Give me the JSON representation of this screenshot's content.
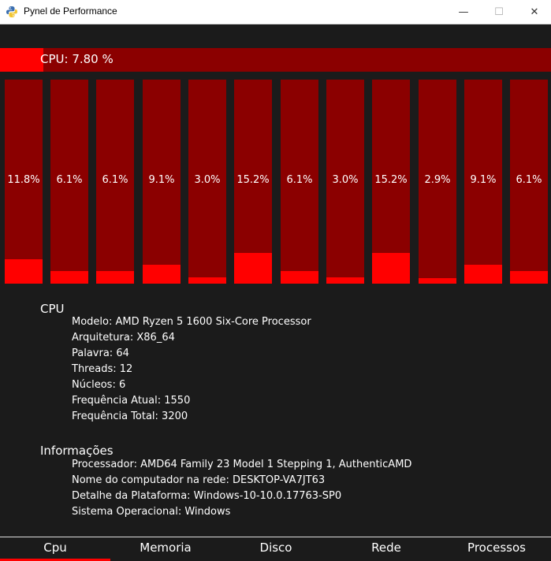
{
  "window": {
    "title": "Pynel de Performance",
    "minimize_glyph": "—",
    "maximize_glyph": "☐",
    "close_glyph": "✕",
    "icon": "python-icon"
  },
  "colors": {
    "background": "#1b1b1b",
    "bar_track": "#8b0000",
    "bar_fill": "#ff0000",
    "text": "#ffffff"
  },
  "cpu_total": {
    "label": "CPU: 7.80 %",
    "percent": 7.8
  },
  "cores": [
    {
      "label": "11.8%",
      "percent": 11.8
    },
    {
      "label": "6.1%",
      "percent": 6.1
    },
    {
      "label": "6.1%",
      "percent": 6.1
    },
    {
      "label": "9.1%",
      "percent": 9.1
    },
    {
      "label": "3.0%",
      "percent": 3.0
    },
    {
      "label": "15.2%",
      "percent": 15.2
    },
    {
      "label": "6.1%",
      "percent": 6.1
    },
    {
      "label": "3.0%",
      "percent": 3.0
    },
    {
      "label": "15.2%",
      "percent": 15.2
    },
    {
      "label": "2.9%",
      "percent": 2.9
    },
    {
      "label": "9.1%",
      "percent": 9.1
    },
    {
      "label": "6.1%",
      "percent": 6.1
    }
  ],
  "cpu_info": {
    "title": "CPU",
    "lines": [
      "Modelo: AMD Ryzen 5 1600 Six-Core Processor",
      "Arquitetura: X86_64",
      "Palavra: 64",
      "Threads: 12",
      "Núcleos: 6",
      "Frequência Atual: 1550",
      "Frequência Total: 3200"
    ]
  },
  "system_info": {
    "title": "Informações",
    "lines": [
      "Processador: AMD64 Family 23 Model 1 Stepping 1, AuthenticAMD",
      "Nome do computador na rede: DESKTOP-VA7JT63",
      "Detalhe da Plataforma: Windows-10-10.0.17763-SP0",
      "Sistema Operacional: Windows"
    ]
  },
  "tabs": [
    {
      "label": "Cpu",
      "active": true
    },
    {
      "label": "Memoria",
      "active": false
    },
    {
      "label": "Disco",
      "active": false
    },
    {
      "label": "Rede",
      "active": false
    },
    {
      "label": "Processos",
      "active": false
    }
  ]
}
